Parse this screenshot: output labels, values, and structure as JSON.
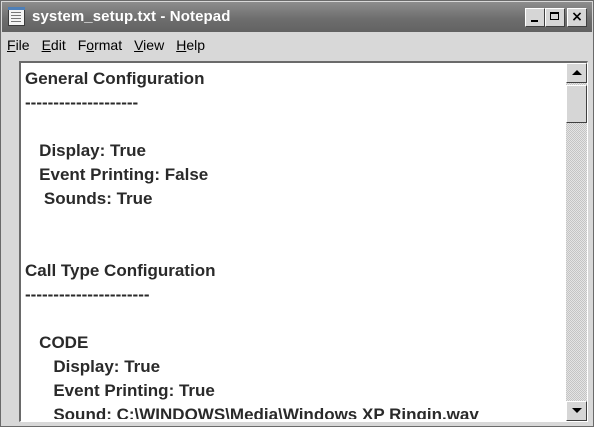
{
  "window": {
    "title": "system_setup.txt - Notepad",
    "icon": "notepad-icon"
  },
  "caption_buttons": {
    "minimize_icon": "minimize-icon",
    "maximize_icon": "maximize-icon",
    "close_icon": "close-icon",
    "close_glyph": "×"
  },
  "menu": {
    "items": [
      {
        "mnemonic": "F",
        "rest": "ile"
      },
      {
        "mnemonic": "E",
        "rest": "dit"
      },
      {
        "prefix": "F",
        "mnemonic": "o",
        "rest": "rmat"
      },
      {
        "mnemonic": "V",
        "rest": "iew"
      },
      {
        "mnemonic": "H",
        "rest": "elp"
      }
    ]
  },
  "document": {
    "lines": [
      "General Configuration",
      "--------------------",
      "",
      "   Display: True",
      "   Event Printing: False",
      "    Sounds: True",
      "",
      "",
      "Call Type Configuration",
      "----------------------",
      "",
      "   CODE",
      "      Display: True",
      "      Event Printing: True",
      "      Sound: C:\\WINDOWS\\Media\\Windows XP Ringin.wav"
    ]
  }
}
